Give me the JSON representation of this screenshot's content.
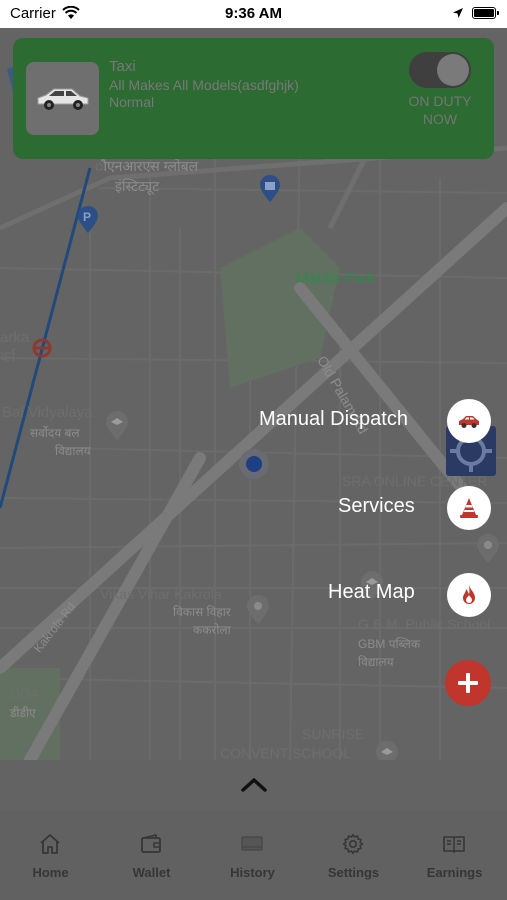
{
  "status_bar": {
    "carrier": "Carrier",
    "time": "9:36 AM"
  },
  "vehicle_card": {
    "vehicle_type": "Taxi",
    "make_model": "All Makes All Models(asdfghjk)",
    "service_level": "Normal",
    "duty_status": "ON DUTY NOW",
    "duty_toggle_on": true,
    "card_color": "#2c6b31"
  },
  "map": {
    "labels": {
      "top_area_1": "ौएनआरएस ग्लोबल",
      "top_area_2": "इंस्टिट्यूट",
      "park": "Mahila Park",
      "road_palam": "Old Palam Rd",
      "parka": "arka",
      "parka_hi": "र्का",
      "school_1": "Bal Vidyalaya",
      "school_1_hi_1": "सर्वोदय बल",
      "school_1_hi_2": "विद्यालय",
      "sra": "SRA ONLINE CENTER",
      "vikas_vihar": "Vikas Vihar Kakrola",
      "vikas_vihar_hi_1": "विकास विहार",
      "vikas_vihar_hi_2": "ककरोला",
      "road_kakrola": "Kakrola Rd",
      "gbm": "G.B.M. Public School",
      "gbm_hi_1": "GBM पब्लिक",
      "gbm_hi_2": "विद्यालय",
      "dda": "DDA",
      "dda_hi": "डीडीए",
      "sunrise_1": "SUNRISE",
      "sunrise_2": "CONVENT SCHOOL"
    }
  },
  "fab_menu": {
    "items": [
      {
        "label": "Manual Dispatch",
        "icon": "car-icon"
      },
      {
        "label": "Services",
        "icon": "traffic-cone-icon"
      },
      {
        "label": "Heat Map",
        "icon": "flame-icon"
      }
    ],
    "accent_color": "#c0362c"
  },
  "tabs": [
    {
      "label": "Home",
      "icon": "home-icon"
    },
    {
      "label": "Wallet",
      "icon": "wallet-icon"
    },
    {
      "label": "History",
      "icon": "history-icon"
    },
    {
      "label": "Settings",
      "icon": "gear-icon"
    },
    {
      "label": "Earnings",
      "icon": "earnings-icon"
    }
  ]
}
